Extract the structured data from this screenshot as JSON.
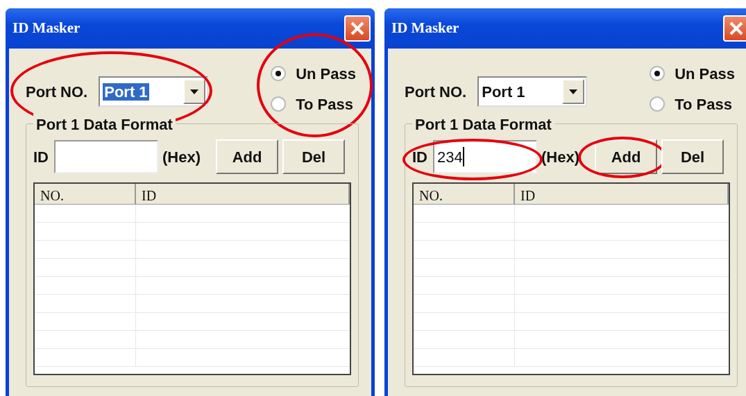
{
  "windows": [
    {
      "title": "ID Masker",
      "port_label": "Port NO.",
      "port_value": "Port 1",
      "port_value_selected": true,
      "port_circled": true,
      "radios": [
        {
          "label": "Un Pass",
          "selected": true
        },
        {
          "label": "To Pass",
          "selected": false
        }
      ],
      "radios_circled": true,
      "group_title": "Port 1 Data Format",
      "id_label": "ID",
      "id_focused": false,
      "id_circled": false,
      "hex_label": "(Hex)",
      "buttons": [
        {
          "label": "Add",
          "circled": false
        },
        {
          "label": "Del",
          "circled": false
        }
      ],
      "columns": [
        "NO.",
        "ID"
      ]
    },
    {
      "title": "ID Masker",
      "port_label": "Port NO.",
      "port_value": "Port 1",
      "port_value_selected": false,
      "port_circled": false,
      "radios": [
        {
          "label": "Un Pass",
          "selected": true
        },
        {
          "label": "To Pass",
          "selected": false
        }
      ],
      "radios_circled": false,
      "group_title": "Port 1 Data Format",
      "id_label": "ID",
      "id_value": "234",
      "id_focused": true,
      "id_circled": true,
      "hex_label": "(Hex)",
      "buttons": [
        {
          "label": "Add",
          "circled": true
        },
        {
          "label": "Del",
          "circled": false
        }
      ],
      "columns": [
        "NO.",
        "ID"
      ]
    }
  ]
}
